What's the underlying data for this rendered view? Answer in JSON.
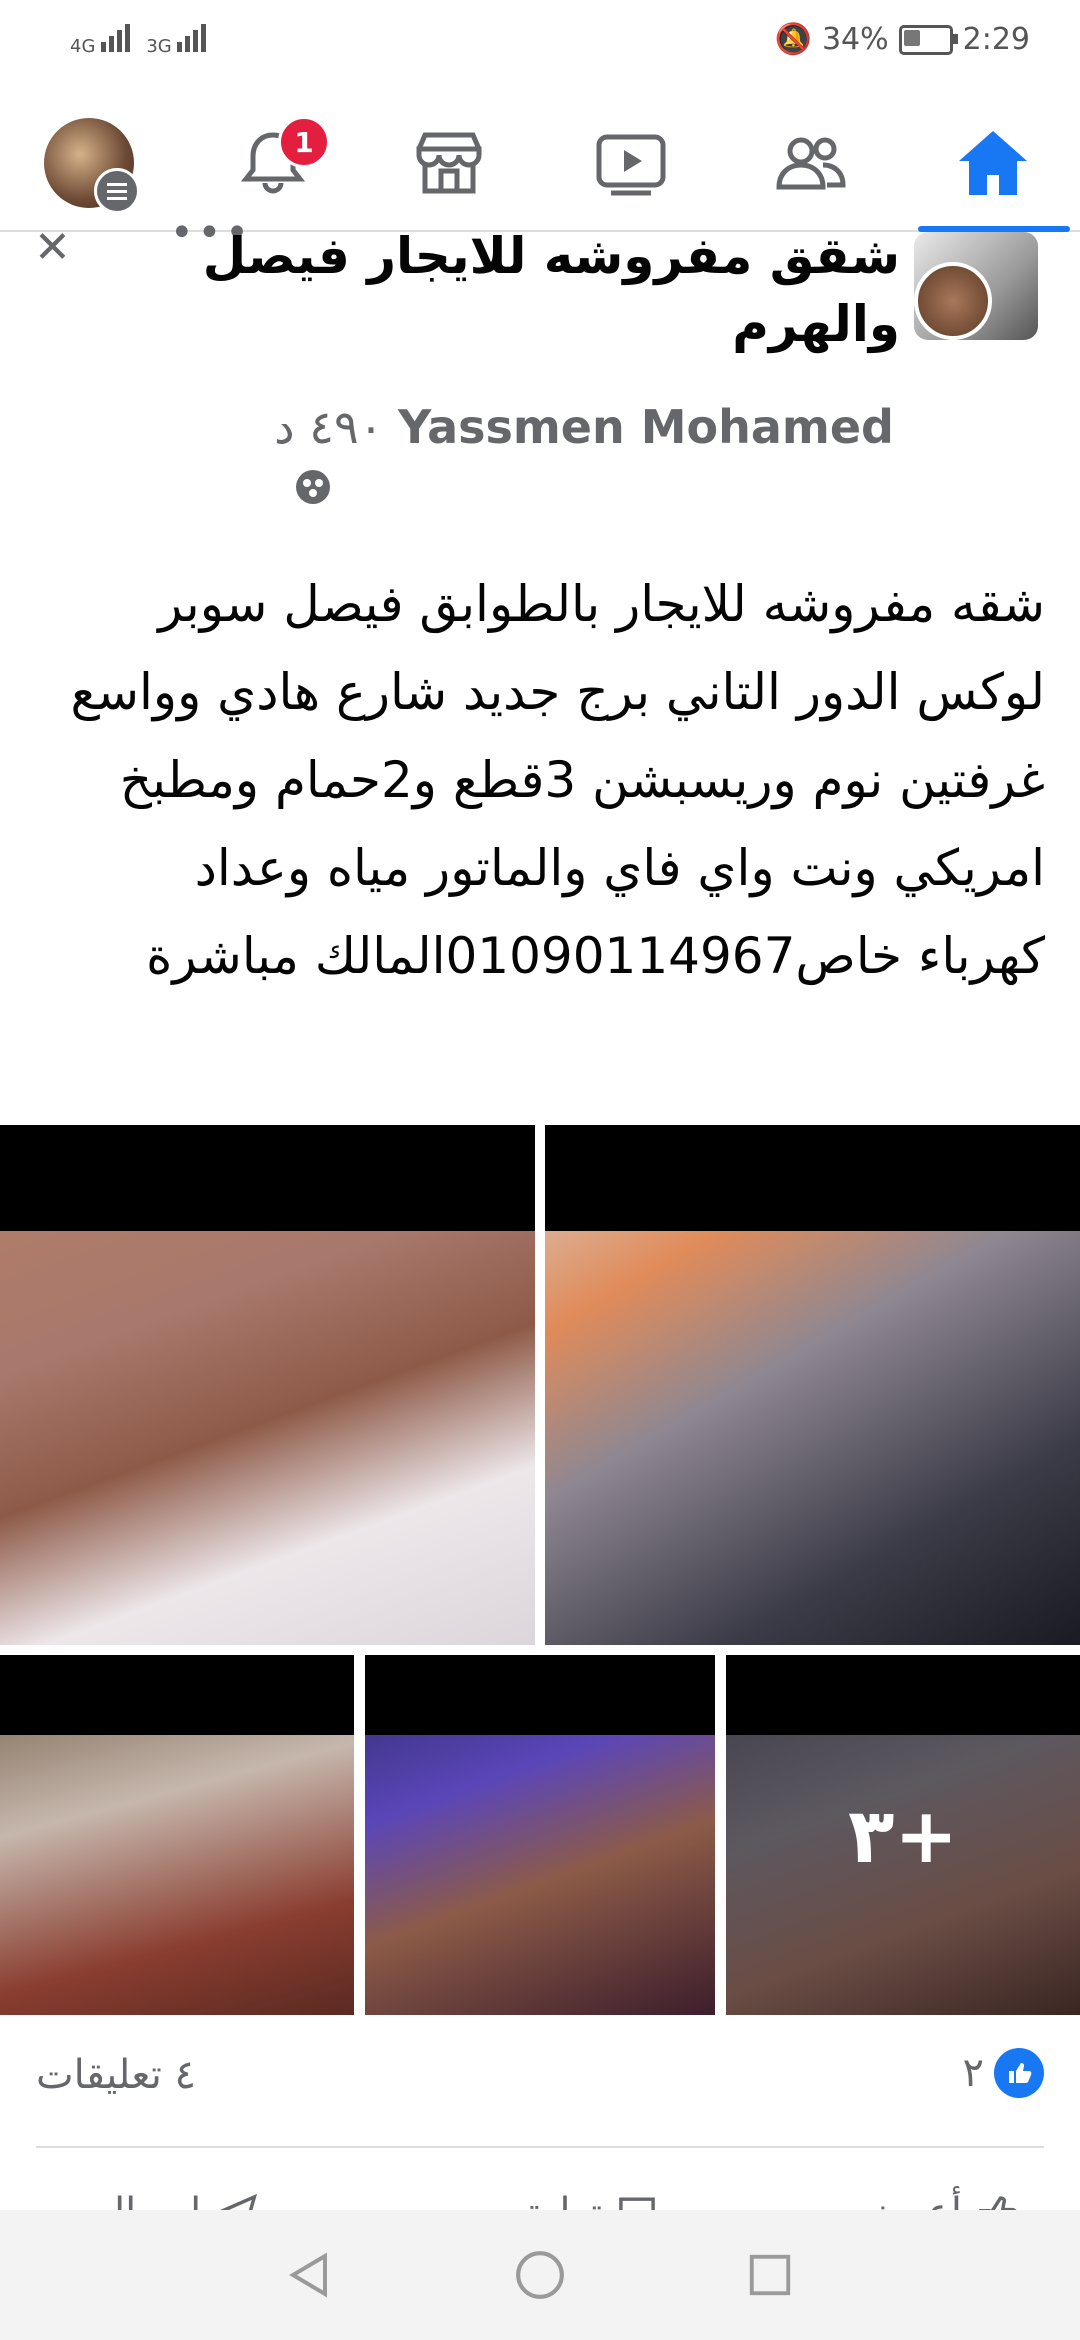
{
  "status_bar": {
    "network_label_1": "4G",
    "network_label_2": "3G",
    "battery": "34%",
    "time": "2:29"
  },
  "nav": {
    "notification_badge": "1",
    "icons": [
      "profile-avatar",
      "bell-icon",
      "marketplace-icon",
      "video-icon",
      "groups-icon",
      "home-icon"
    ],
    "accent": "#1877f2"
  },
  "post": {
    "group_title": "شقق مفروشه للايجار فيصل والهرم",
    "author": "Yassmen Mohamed",
    "time": "٤٩٠ د",
    "body": "شقه مفروشه للايجار بالطوابق فيصل سوبر لوكس الدور التاني برج جديد شارع هادي وواسع غرفتين نوم وريسبشن 3قطع و2حمام ومطبخ امريكي ونت واي فاي والماتور مياه وعداد كهرباء خاص01090114967المالك مباشرة",
    "more_photos": "+٣",
    "comments": "٤ تعليقات",
    "likes": "٢"
  },
  "actions": {
    "like": "أعجبني",
    "comment": "تعليق",
    "share": "إرسال"
  }
}
